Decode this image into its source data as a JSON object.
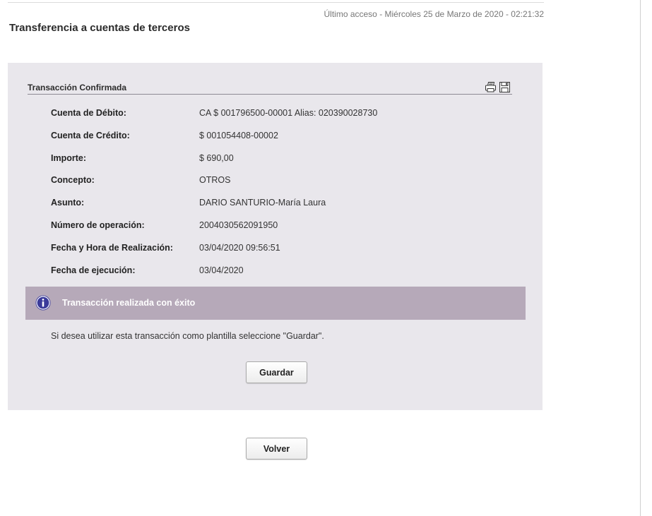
{
  "header": {
    "last_access": "Último acceso - Miércoles 25 de Marzo de 2020 - 02:21:32",
    "page_title": "Transferencia a cuentas de terceros"
  },
  "section": {
    "title": "Transacción Confirmada",
    "icons": [
      "printer-icon",
      "save-disk-icon"
    ]
  },
  "details": {
    "rows": [
      {
        "label": "Cuenta de Débito:",
        "value": "CA $  001796500-00001 Alias: 020390028730"
      },
      {
        "label": "Cuenta de Crédito:",
        "value": "$ 001054408-00002"
      },
      {
        "label": "Importe:",
        "value": "$ 690,00"
      },
      {
        "label": "Concepto:",
        "value": "OTROS"
      },
      {
        "label": "Asunto:",
        "value": "DARIO SANTURIO-María Laura"
      },
      {
        "label": "Número de operación:",
        "value": "2004030562091950"
      },
      {
        "label": "Fecha y Hora de Realización:",
        "value": "03/04/2020 09:56:51"
      },
      {
        "label": "Fecha de ejecución:",
        "value": "03/04/2020"
      }
    ]
  },
  "info_banner": {
    "icon": "info-icon",
    "message": "Transacción realizada con éxito"
  },
  "template_note": "Si desea utilizar esta transacción como plantilla seleccione \"Guardar\".",
  "buttons": {
    "save_label": "Guardar",
    "back_label": "Volver"
  },
  "colors": {
    "panel_bg": "#e9e7ec",
    "banner_bg": "#b6a9b9",
    "info_icon": "#3b3b9a"
  }
}
